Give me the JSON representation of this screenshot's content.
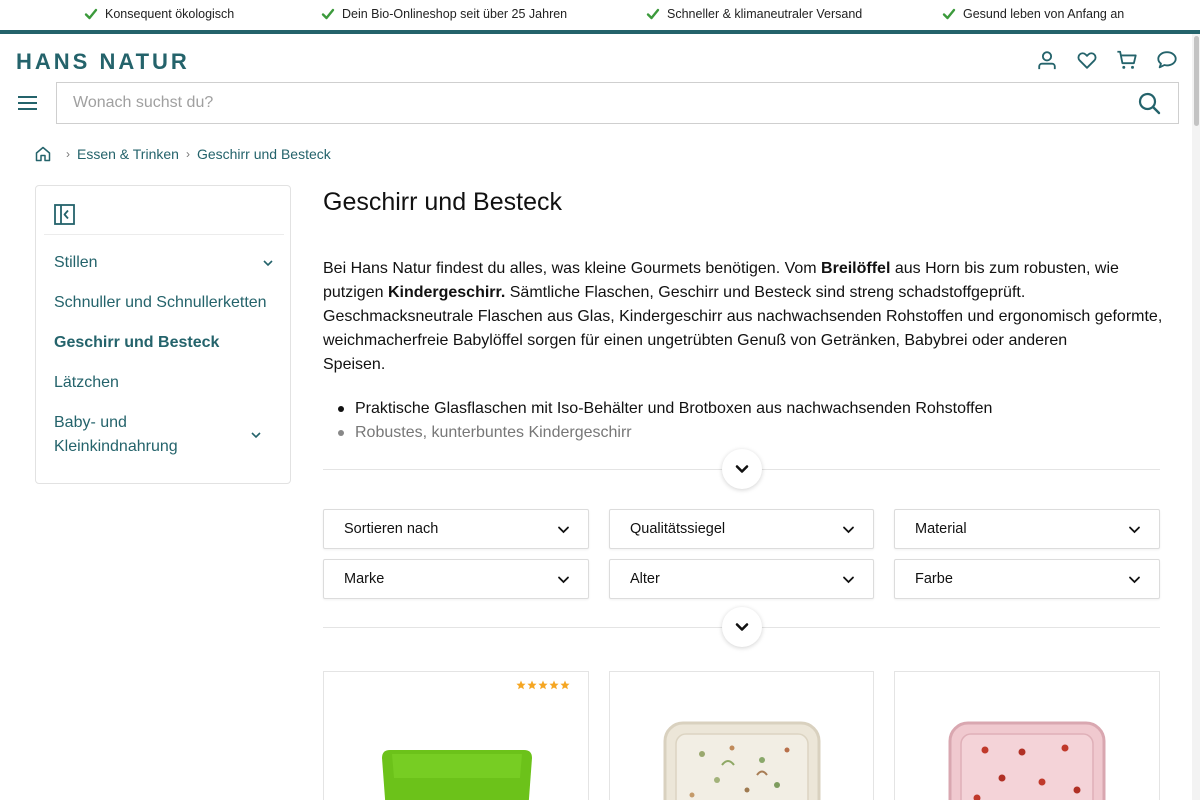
{
  "usp": [
    "Konsequent ökologisch",
    "Dein Bio-Onlineshop seit über 25 Jahren",
    "Schneller & klimaneutraler Versand",
    "Gesund leben von Anfang an"
  ],
  "logo": "HANS NATUR",
  "search": {
    "placeholder": "Wonach suchst du?"
  },
  "breadcrumb": [
    "Essen & Trinken",
    "Geschirr und Besteck"
  ],
  "sidebar": {
    "items": [
      {
        "label": "Stillen",
        "has_children": true,
        "active": false
      },
      {
        "label": "Schnuller und Schnullerketten",
        "has_children": false,
        "active": false
      },
      {
        "label": "Geschirr und Besteck",
        "has_children": false,
        "active": true
      },
      {
        "label": "Lätzchen",
        "has_children": false,
        "active": false
      },
      {
        "label": "Baby- und Kleinkindnahrung",
        "has_children": true,
        "active": false
      }
    ]
  },
  "main": {
    "title": "Geschirr und Besteck",
    "intro": {
      "p1": "Bei Hans Natur findest du alles, was kleine Gourmets benötigen. Vom ",
      "b1": "Breilöffel",
      "p2": " aus Horn bis zum robusten, wie putzigen ",
      "b2": "Kindergeschirr.",
      "p3": " Sämtliche Flaschen, Geschirr und Besteck sind streng schadstoffgeprüft. Geschmacksneutrale Flaschen aus Glas, Kindergeschirr aus nachwachsenden Rohstoffen und ergonomisch geformte, weichmacherfreie Babylöffel sorgen für einen ungetrübten Genuß von Getränken, Babybrei oder anderen",
      "p4": "Speisen."
    },
    "bullets": [
      "Praktische Glasflaschen mit Iso-Behälter und Brotboxen aus nachwachsenden Rohstoffen",
      "Robustes, kunterbuntes Kindergeschirr"
    ]
  },
  "filters": [
    "Sortieren nach",
    "Qualitätssiegel",
    "Material",
    "Marke",
    "Alter",
    "Farbe"
  ],
  "products": [
    {
      "rating": 5
    },
    {},
    {}
  ],
  "colors": {
    "brand": "#24636b",
    "check": "#3c9a3c",
    "star": "#f5a623"
  }
}
